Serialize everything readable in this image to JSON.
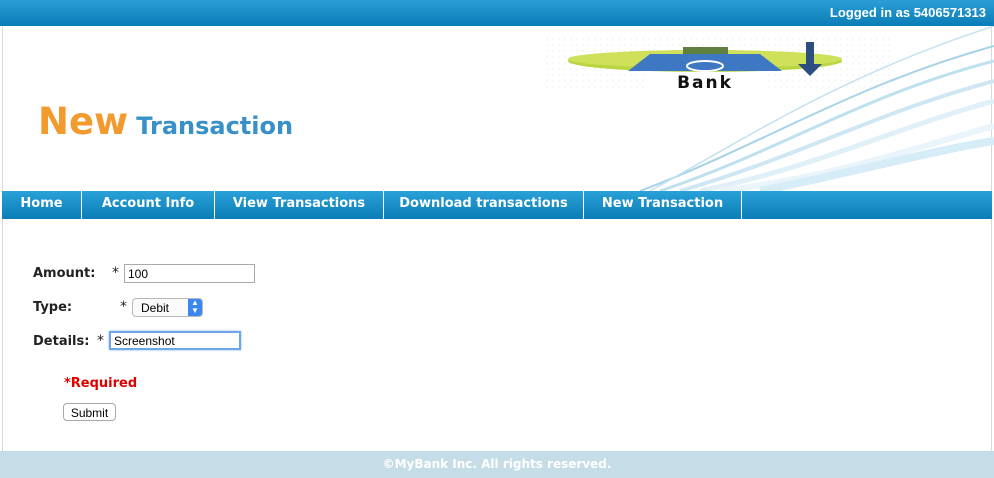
{
  "header": {
    "login_text": "Logged in as 5406571313",
    "title_part1": "New",
    "title_part2": "Transaction",
    "logo_text": "Bank"
  },
  "nav": {
    "items": [
      {
        "label": "Home"
      },
      {
        "label": "Account Info"
      },
      {
        "label": "View Transactions"
      },
      {
        "label": "Download transactions"
      },
      {
        "label": "New Transaction"
      }
    ]
  },
  "form": {
    "amount_label": "Amount:",
    "amount_value": "100",
    "type_label": "Type:",
    "type_value": "Debit",
    "details_label": "Details:",
    "details_value": "Screenshot",
    "required_marker": "*",
    "required_note": "*Required",
    "submit_label": "Submit"
  },
  "footer": {
    "text": "©MyBank Inc. All rights reserved."
  },
  "colors": {
    "brand_blue": "#0a7db8",
    "title_orange": "#f39a2e",
    "title_blue": "#3790c6",
    "required_red": "#e00000",
    "footer_bg": "#c5dde6"
  }
}
